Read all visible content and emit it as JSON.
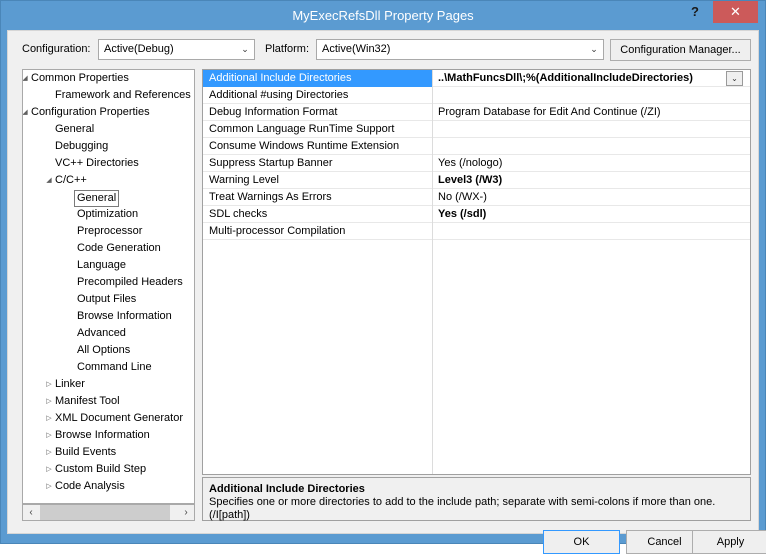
{
  "window": {
    "title": "MyExecRefsDll Property Pages",
    "help_label": "?",
    "close_label": "✕",
    "titlebar_color": "#5b9bd1",
    "close_color": "#cc5a5a",
    "accent_color": "#3399ff"
  },
  "toolbar": {
    "configuration_label": "Configuration:",
    "configuration_value": "Active(Debug)",
    "platform_label": "Platform:",
    "platform_value": "Active(Win32)",
    "config_manager_label": "Configuration Manager...",
    "dropdown_glyph": "⌄"
  },
  "tree": {
    "items": [
      {
        "label": "Common Properties",
        "indent": 8,
        "twisty": "expanded",
        "selected": false
      },
      {
        "label": "Framework and References",
        "indent": 32,
        "twisty": "none",
        "selected": false
      },
      {
        "label": "Configuration Properties",
        "indent": 8,
        "twisty": "expanded",
        "selected": false
      },
      {
        "label": "General",
        "indent": 32,
        "twisty": "none",
        "selected": false
      },
      {
        "label": "Debugging",
        "indent": 32,
        "twisty": "none",
        "selected": false
      },
      {
        "label": "VC++ Directories",
        "indent": 32,
        "twisty": "none",
        "selected": false
      },
      {
        "label": "C/C++",
        "indent": 32,
        "twisty": "expanded",
        "selected": false
      },
      {
        "label": "General",
        "indent": 54,
        "twisty": "none",
        "selected": true
      },
      {
        "label": "Optimization",
        "indent": 54,
        "twisty": "none",
        "selected": false
      },
      {
        "label": "Preprocessor",
        "indent": 54,
        "twisty": "none",
        "selected": false
      },
      {
        "label": "Code Generation",
        "indent": 54,
        "twisty": "none",
        "selected": false
      },
      {
        "label": "Language",
        "indent": 54,
        "twisty": "none",
        "selected": false
      },
      {
        "label": "Precompiled Headers",
        "indent": 54,
        "twisty": "none",
        "selected": false
      },
      {
        "label": "Output Files",
        "indent": 54,
        "twisty": "none",
        "selected": false
      },
      {
        "label": "Browse Information",
        "indent": 54,
        "twisty": "none",
        "selected": false
      },
      {
        "label": "Advanced",
        "indent": 54,
        "twisty": "none",
        "selected": false
      },
      {
        "label": "All Options",
        "indent": 54,
        "twisty": "none",
        "selected": false
      },
      {
        "label": "Command Line",
        "indent": 54,
        "twisty": "none",
        "selected": false
      },
      {
        "label": "Linker",
        "indent": 32,
        "twisty": "collapsed",
        "selected": false
      },
      {
        "label": "Manifest Tool",
        "indent": 32,
        "twisty": "collapsed",
        "selected": false
      },
      {
        "label": "XML Document Generator",
        "indent": 32,
        "twisty": "collapsed",
        "selected": false
      },
      {
        "label": "Browse Information",
        "indent": 32,
        "twisty": "collapsed",
        "selected": false
      },
      {
        "label": "Build Events",
        "indent": 32,
        "twisty": "collapsed",
        "selected": false
      },
      {
        "label": "Custom Build Step",
        "indent": 32,
        "twisty": "collapsed",
        "selected": false
      },
      {
        "label": "Code Analysis",
        "indent": 32,
        "twisty": "collapsed",
        "selected": false
      }
    ],
    "twisty_expanded_glyph": "◢",
    "twisty_collapsed_glyph": "▷",
    "scrollbar": {
      "left_glyph": "‹",
      "right_glyph": "›"
    }
  },
  "grid": {
    "rows": [
      {
        "name": "Additional Include Directories",
        "value": "..\\MathFuncsDll\\;%(AdditionalIncludeDirectories)",
        "bold": true,
        "selected": true
      },
      {
        "name": "Additional #using Directories",
        "value": "",
        "bold": false,
        "selected": false
      },
      {
        "name": "Debug Information Format",
        "value": "Program Database for Edit And Continue (/ZI)",
        "bold": false,
        "selected": false
      },
      {
        "name": "Common Language RunTime Support",
        "value": "",
        "bold": false,
        "selected": false
      },
      {
        "name": "Consume Windows Runtime Extension",
        "value": "",
        "bold": false,
        "selected": false
      },
      {
        "name": "Suppress Startup Banner",
        "value": "Yes (/nologo)",
        "bold": false,
        "selected": false
      },
      {
        "name": "Warning Level",
        "value": "Level3 (/W3)",
        "bold": true,
        "selected": false
      },
      {
        "name": "Treat Warnings As Errors",
        "value": "No (/WX-)",
        "bold": false,
        "selected": false
      },
      {
        "name": "SDL checks",
        "value": "Yes (/sdl)",
        "bold": true,
        "selected": false
      },
      {
        "name": "Multi-processor Compilation",
        "value": "",
        "bold": false,
        "selected": false
      }
    ],
    "value_dropdown_glyph": "⌄"
  },
  "description": {
    "title": "Additional Include Directories",
    "body": "Specifies one or more directories to add to the include path; separate with semi-colons if more than one. (/I[path])"
  },
  "buttons": {
    "ok": "OK",
    "cancel": "Cancel",
    "apply": "Apply"
  }
}
